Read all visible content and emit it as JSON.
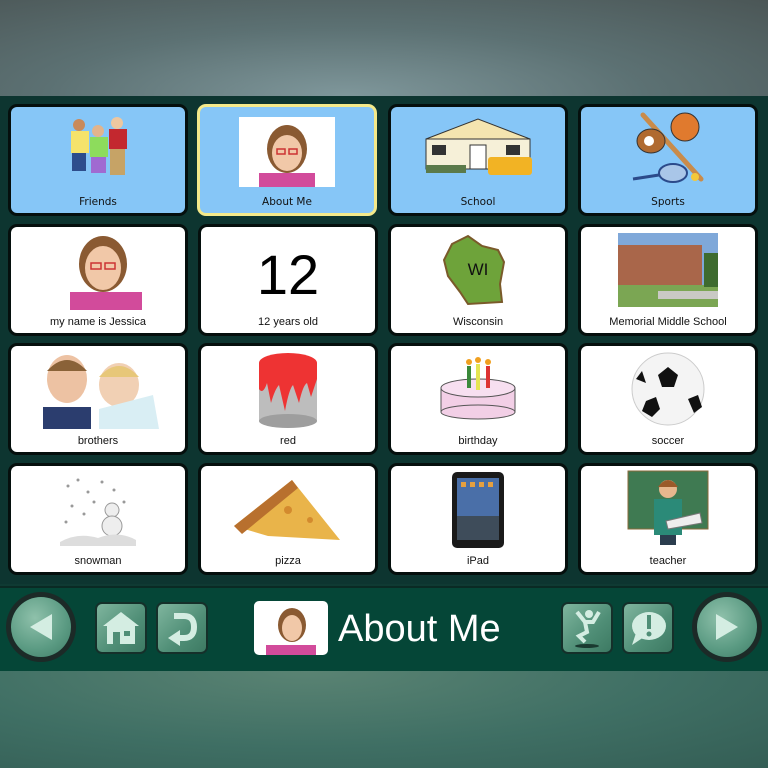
{
  "board": {
    "title": "About Me",
    "rows": [
      [
        {
          "label": "Friends",
          "icon": "friends-icon",
          "style": "category",
          "selected": false
        },
        {
          "label": "About Me",
          "icon": "girl-photo-icon",
          "style": "category",
          "selected": true
        },
        {
          "label": "School",
          "icon": "school-building-icon",
          "style": "category",
          "selected": false
        },
        {
          "label": "Sports",
          "icon": "sports-equipment-icon",
          "style": "category",
          "selected": false
        }
      ],
      [
        {
          "label": "my name is Jessica",
          "icon": "girl-photo-icon"
        },
        {
          "label": "12 years old",
          "icon": "number-icon",
          "big_text": "12"
        },
        {
          "label": "Wisconsin",
          "icon": "wisconsin-map-icon",
          "big_text": "WI"
        },
        {
          "label": "Memorial Middle School",
          "icon": "school-photo-icon"
        }
      ],
      [
        {
          "label": "brothers",
          "icon": "brothers-photo-icon"
        },
        {
          "label": "red",
          "icon": "red-paint-can-icon"
        },
        {
          "label": "birthday",
          "icon": "birthday-cake-icon"
        },
        {
          "label": "soccer",
          "icon": "soccer-ball-icon"
        }
      ],
      [
        {
          "label": "snowman",
          "icon": "snowman-icon"
        },
        {
          "label": "pizza",
          "icon": "pizza-slice-icon"
        },
        {
          "label": "iPad",
          "icon": "ipad-icon"
        },
        {
          "label": "teacher",
          "icon": "teacher-icon"
        }
      ]
    ]
  },
  "toolbar": {
    "back": "back-arrow-icon",
    "home": "home-icon",
    "undo": "undo-icon",
    "page_title": "About Me",
    "action": "jump-icon",
    "alert": "exclamation-speech-icon",
    "forward": "forward-arrow-icon"
  },
  "colors": {
    "category_tile": "#86c6f7",
    "selected_border": "#f4e98a",
    "toolbar_bg": "#054637"
  }
}
